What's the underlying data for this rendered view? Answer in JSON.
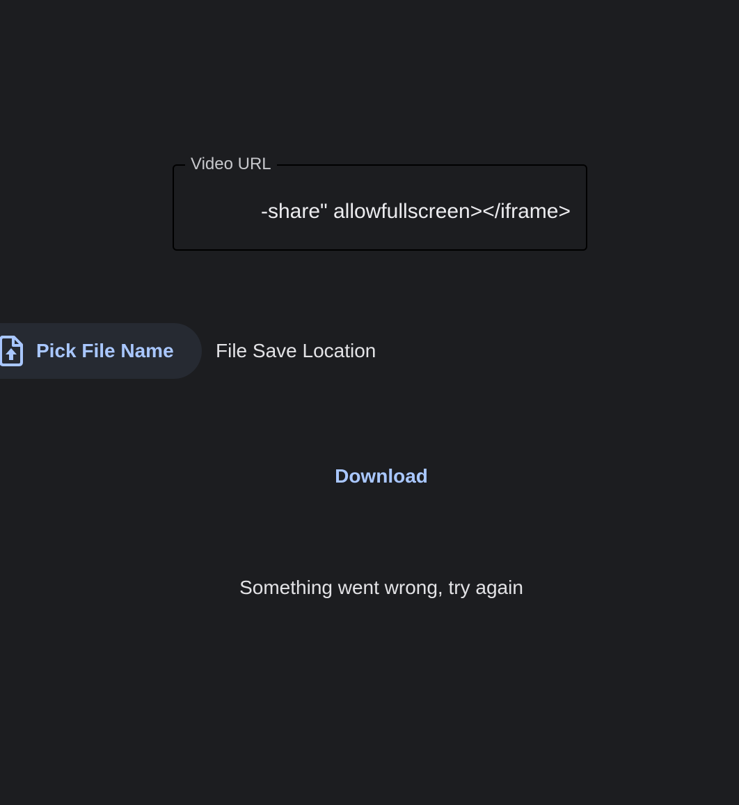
{
  "url_field": {
    "label": "Video URL",
    "value": "-share\" allowfullscreen></iframe>"
  },
  "file_picker": {
    "button_label": "Pick File Name",
    "icon": "file-upload-icon",
    "location_text": "File Save Location"
  },
  "download": {
    "label": "Download"
  },
  "status": {
    "message": "Something went wrong, try again"
  },
  "colors": {
    "background": "#1c1d20",
    "accent": "#a9c7ff",
    "button_surface": "#262a32",
    "text": "#e3e3e6"
  }
}
